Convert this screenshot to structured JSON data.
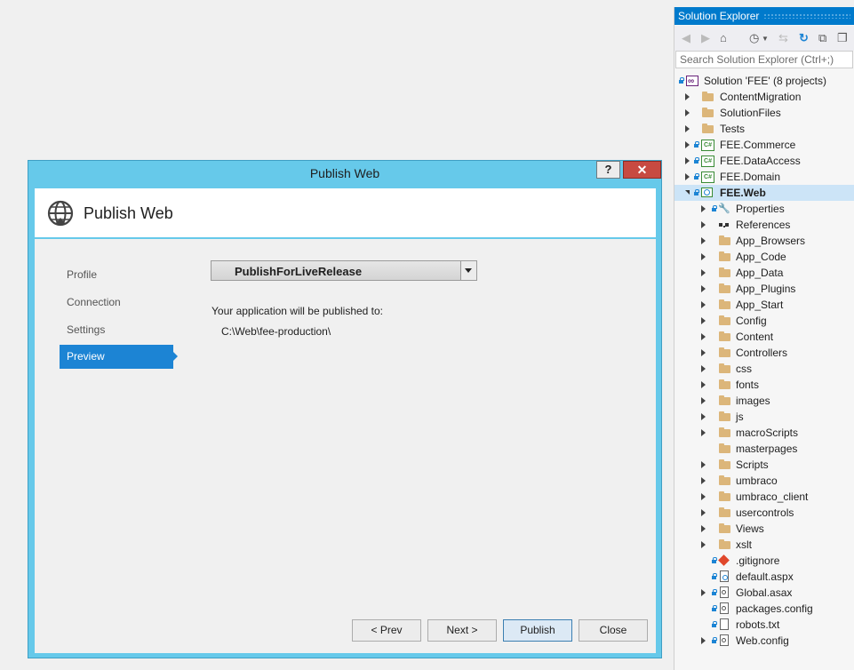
{
  "dialog": {
    "title": "Publish Web",
    "help_label": "?",
    "close_label": "✕",
    "header_title": "Publish Web",
    "nav": [
      {
        "label": "Profile"
      },
      {
        "label": "Connection"
      },
      {
        "label": "Settings"
      },
      {
        "label": "Preview",
        "active": true
      }
    ],
    "profile_selected": "PublishForLiveRelease",
    "published_label": "Your application will be published to:",
    "published_path": "C:\\Web\\fee-production\\",
    "buttons": {
      "prev": "< Prev",
      "next": "Next >",
      "publish": "Publish",
      "close": "Close"
    }
  },
  "solution_explorer": {
    "title": "Solution Explorer",
    "search_placeholder": "Search Solution Explorer (Ctrl+;)",
    "solution": "Solution 'FEE' (8 projects)",
    "projects": [
      {
        "label": "ContentMigration",
        "type": "folder"
      },
      {
        "label": "SolutionFiles",
        "type": "folder"
      },
      {
        "label": "Tests",
        "type": "folder"
      },
      {
        "label": "FEE.Commerce",
        "type": "csproj"
      },
      {
        "label": "FEE.DataAccess",
        "type": "csproj"
      },
      {
        "label": "FEE.Domain",
        "type": "csproj"
      },
      {
        "label": "FEE.Web",
        "type": "webproj",
        "selected": true
      }
    ],
    "web_children": [
      "Properties",
      "References",
      "App_Browsers",
      "App_Code",
      "App_Data",
      "App_Plugins",
      "App_Start",
      "Config",
      "Content",
      "Controllers",
      "css",
      "fonts",
      "images",
      "js",
      "macroScripts",
      "masterpages",
      "Scripts",
      "umbraco",
      "umbraco_client",
      "usercontrols",
      "Views",
      "xslt",
      ".gitignore",
      "default.aspx",
      "Global.asax",
      "packages.config",
      "robots.txt",
      "Web.config"
    ]
  }
}
